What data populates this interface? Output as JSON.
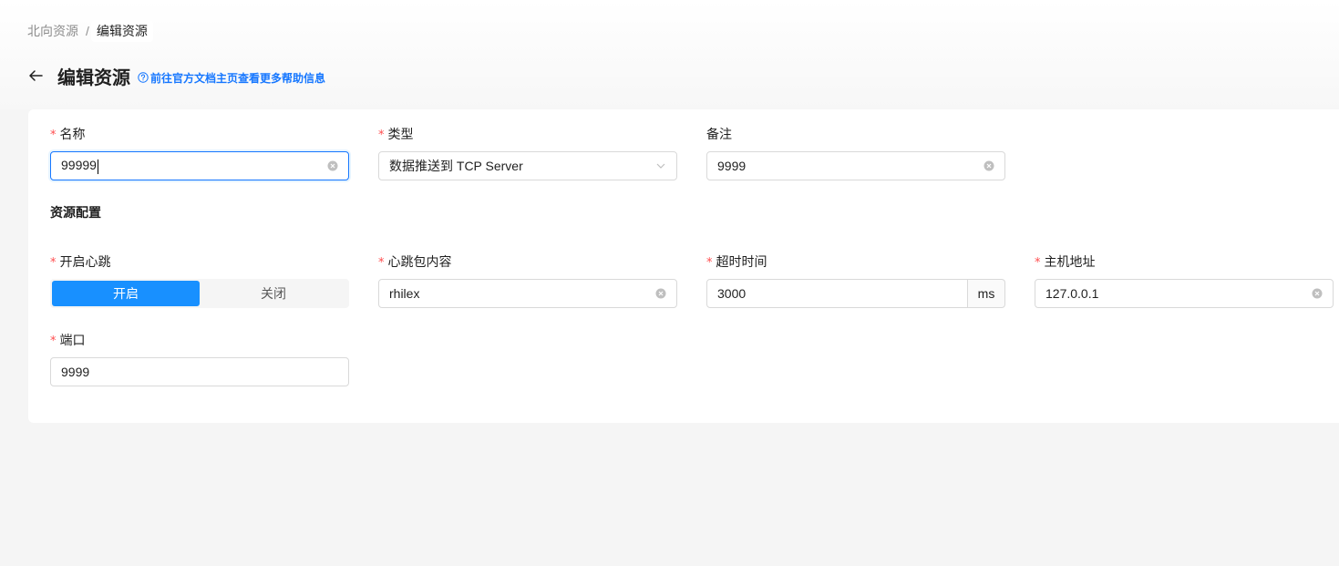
{
  "breadcrumb": {
    "parent": "北向资源",
    "separator": "/",
    "current": "编辑资源"
  },
  "header": {
    "title": "编辑资源",
    "help_link": "前往官方文档主页查看更多帮助信息"
  },
  "form": {
    "name": {
      "label": "名称",
      "required": "*",
      "value": "99999"
    },
    "type": {
      "label": "类型",
      "required": "*",
      "value": "数据推送到 TCP Server"
    },
    "remark": {
      "label": "备注",
      "value": "9999"
    },
    "section_title": "资源配置",
    "heartbeat": {
      "label": "开启心跳",
      "required": "*",
      "on": "开启",
      "off": "关闭",
      "selected": "开启"
    },
    "heartbeat_content": {
      "label": "心跳包内容",
      "required": "*",
      "value": "rhilex"
    },
    "timeout": {
      "label": "超时时间",
      "required": "*",
      "value": "3000",
      "unit": "ms"
    },
    "host": {
      "label": "主机地址",
      "required": "*",
      "value": "127.0.0.1"
    },
    "port": {
      "label": "端口",
      "required": "*",
      "value": "9999"
    }
  },
  "colors": {
    "primary": "#1677ff",
    "segment_active": "#1890ff",
    "required": "#ff4d4f"
  }
}
